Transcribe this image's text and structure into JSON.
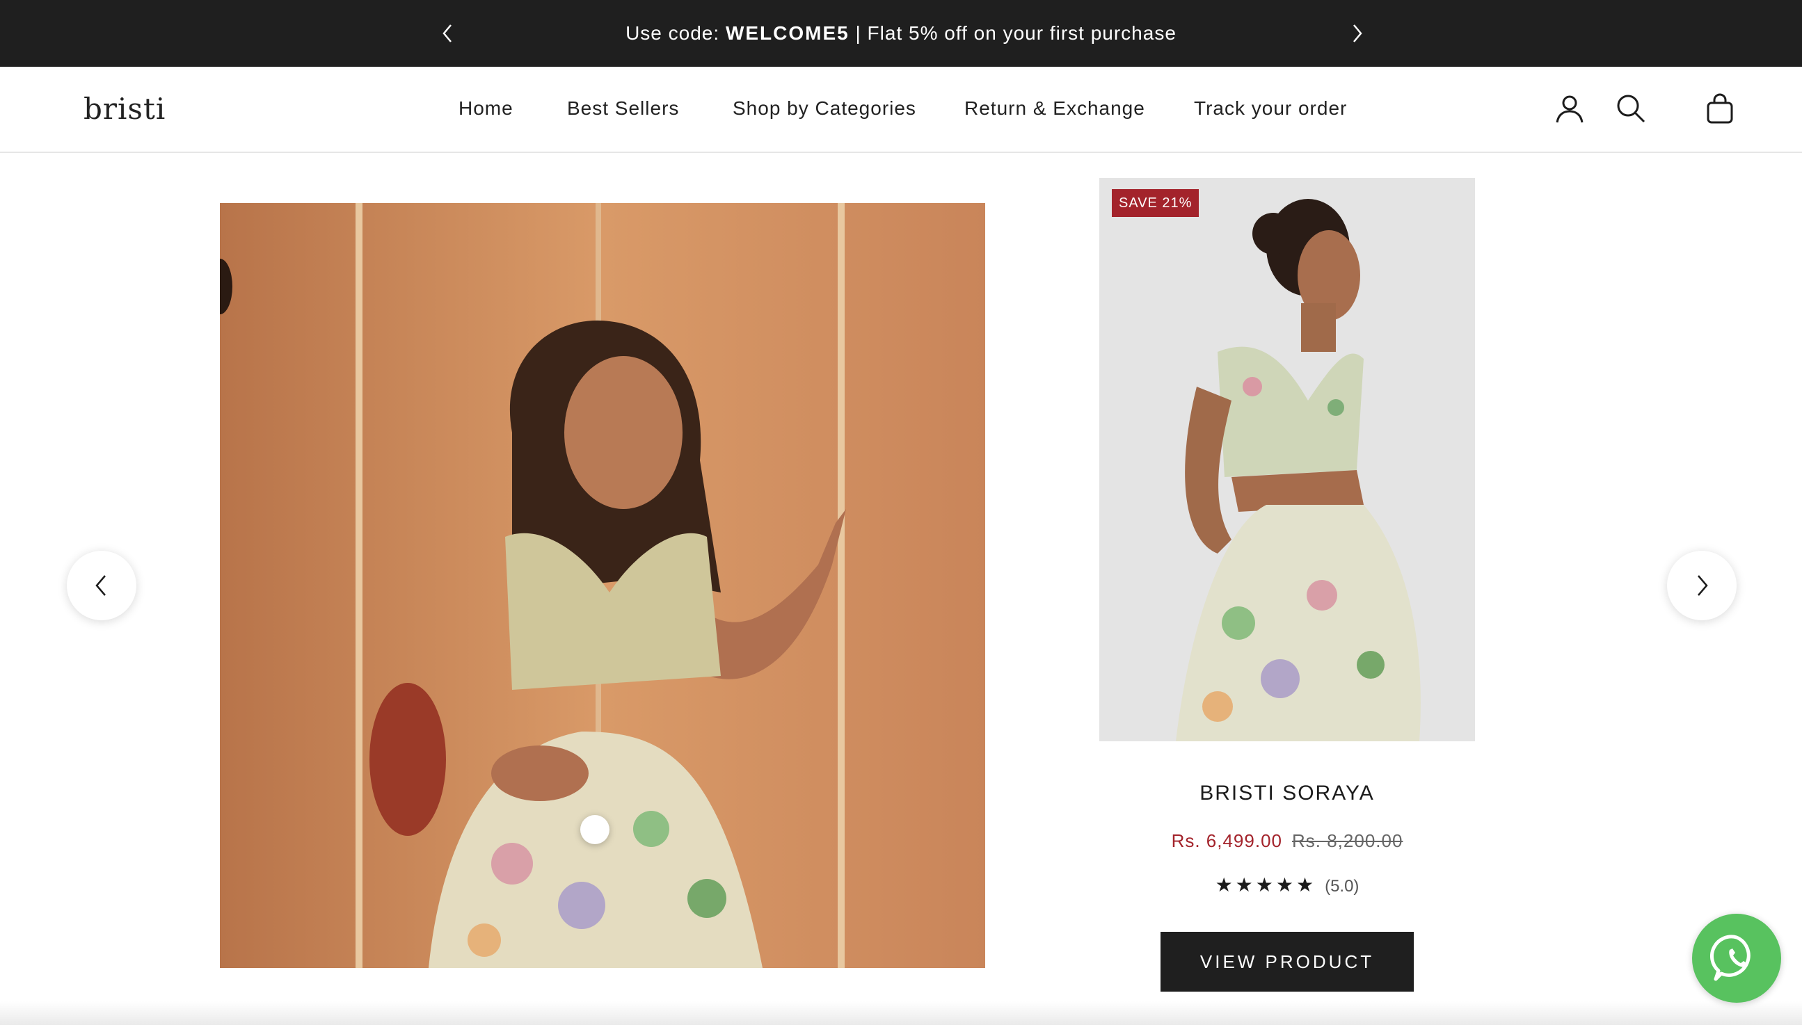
{
  "announcement": {
    "prefix": "Use code: ",
    "code": "WELCOME5",
    "suffix": " | Flat 5% off on your first purchase"
  },
  "header": {
    "logo": "bristi",
    "nav": [
      {
        "label": "Home"
      },
      {
        "label": "Best Sellers"
      },
      {
        "label": "Shop by Categories"
      },
      {
        "label": "Return & Exchange"
      },
      {
        "label": "Track your order"
      }
    ],
    "icons": [
      "account-icon",
      "search-icon",
      "cart-icon"
    ]
  },
  "product": {
    "badge": "SAVE 21%",
    "title": "BRISTI SORAYA",
    "sale_price": "Rs. 6,499.00",
    "compare_price": "Rs. 8,200.00",
    "stars": "★★★★★",
    "rating": "(5.0)",
    "button": "VIEW PRODUCT"
  },
  "colors": {
    "announcement_bg": "#1f1f1f",
    "sale": "#a3232b",
    "button_bg": "#1f1f1f",
    "whatsapp": "#58c25f"
  }
}
